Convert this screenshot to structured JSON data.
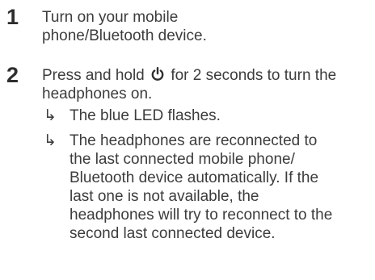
{
  "steps": [
    {
      "number": "1",
      "text": "Turn on your mobile phone/Bluetooth device."
    },
    {
      "number": "2",
      "text_before_icon": "Press and hold",
      "icon": "power-icon",
      "text_after_icon": "for 2 seconds to turn the headphones on.",
      "results": [
        {
          "arrow": "↳",
          "text": "The blue LED flashes."
        },
        {
          "arrow": "↳",
          "text": "The headphones are reconnected to the last connected mobile phone/ Bluetooth device automatically. If the last one is not available, the headphones will try to reconnect to the second last connected device."
        }
      ]
    }
  ]
}
